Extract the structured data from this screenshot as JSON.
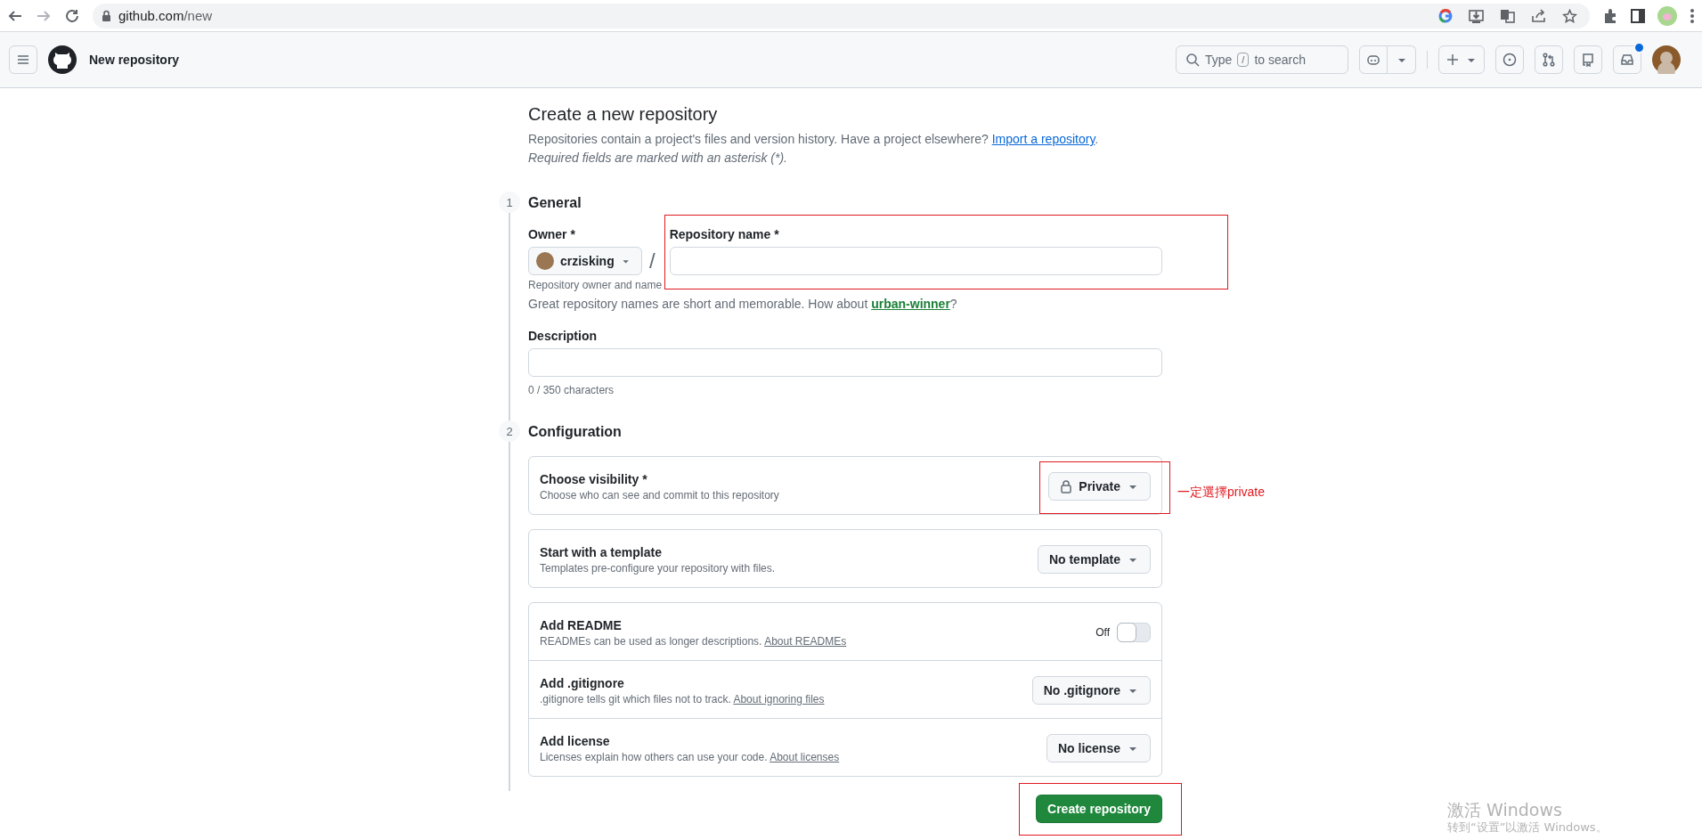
{
  "browser": {
    "url_host": "github.com",
    "url_path": "/new"
  },
  "header": {
    "title": "New repository",
    "search": {
      "prefix": "Type",
      "key": "/",
      "suffix": "to search"
    },
    "inbox_unread": true
  },
  "page": {
    "title": "Create a new repository",
    "intro": "Repositories contain a project's files and version history. Have a project elsewhere? ",
    "import_link": "Import a repository",
    "intro_end": ".",
    "required_note": "Required fields are marked with an asterisk (*)."
  },
  "general": {
    "step": "1",
    "title": "General",
    "owner_label": "Owner *",
    "owner_hint": "Repository owner and name",
    "owner": "crzisking",
    "separator": "/",
    "name_label": "Repository name *",
    "name_highlighted": true,
    "name_hint": "Great repository names are short and memorable. How about ",
    "suggestion": "urban-winner",
    "hint_end": "?",
    "description_label": "Description",
    "char_count": "0 / 350 characters"
  },
  "configuration": {
    "step": "2",
    "title": "Configuration",
    "cards": [
      [
        {
          "kind": "select",
          "title": "Choose visibility *",
          "desc": "Choose who can see and commit to this repository",
          "value": "Private",
          "lock_icon": true,
          "highlighted": true
        }
      ],
      [
        {
          "kind": "select",
          "title": "Start with a template",
          "desc": "Templates pre-configure your repository with files.",
          "value": "No template",
          "lock_icon": false,
          "highlighted": false
        }
      ],
      [
        {
          "kind": "toggle",
          "title": "Add README",
          "desc": "READMEs can be used as longer descriptions. ",
          "link": "About READMEs",
          "state_label": "Off",
          "on": false
        },
        {
          "kind": "select",
          "title": "Add .gitignore",
          "desc": ".gitignore tells git which files not to track. ",
          "link": "About ignoring files",
          "value": "No .gitignore",
          "lock_icon": false,
          "highlighted": false
        },
        {
          "kind": "select",
          "title": "Add license",
          "desc": "Licenses explain how others can use your code. ",
          "link": "About licenses",
          "value": "No license",
          "lock_icon": false,
          "highlighted": false
        }
      ]
    ]
  },
  "submit": {
    "label": "Create repository",
    "highlighted": true
  },
  "annotation_note": "一定選擇private",
  "os_notice": {
    "title": "激活 Windows",
    "subtitle": "转到“设置”以激活 Windows。"
  }
}
